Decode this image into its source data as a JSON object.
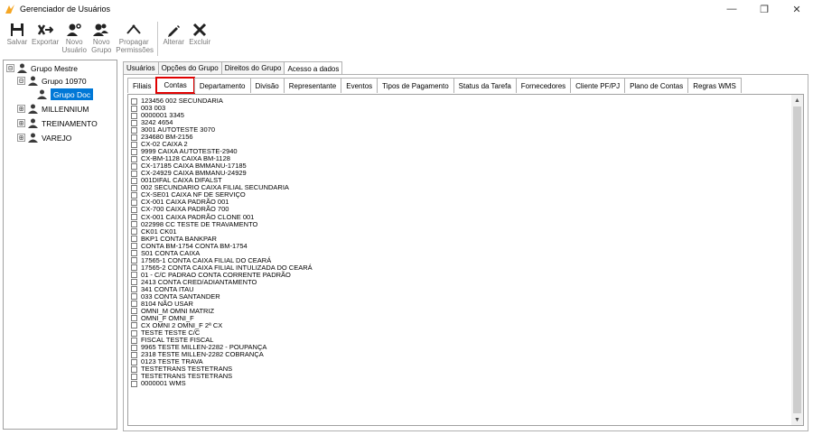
{
  "window": {
    "title": "Gerenciador de Usuários",
    "controls": [
      "—",
      "❐",
      "✕"
    ]
  },
  "toolbar": {
    "buttons": [
      {
        "label": "Salvar",
        "icon": "save-icon"
      },
      {
        "label": "Exportar",
        "icon": "export-icon"
      },
      {
        "label": "Novo Usuário",
        "icon": "new-user-icon"
      },
      {
        "label": "Novo Grupo",
        "icon": "new-group-icon"
      },
      {
        "label": "Propagar Permissões",
        "icon": "propagate-icon"
      },
      {
        "label": "Alterar",
        "icon": "edit-pencil-icon"
      },
      {
        "label": "Excluir",
        "icon": "delete-x-icon"
      }
    ]
  },
  "tree": {
    "root": {
      "expander": "⊟",
      "label": "Grupo Mestre"
    },
    "group": {
      "expander": "⊟",
      "label": "Grupo 10970"
    },
    "selected": {
      "label": "Grupo Doc"
    },
    "others": [
      {
        "expander": "⊞",
        "label": "MILLENNIUM"
      },
      {
        "expander": "⊞",
        "label": "TREINAMENTO"
      },
      {
        "expander": "⊞",
        "label": "VAREJO"
      }
    ]
  },
  "top_tabs": [
    "Usuários",
    "Opções do Grupo",
    "Direitos do Grupo",
    "Acesso a dados"
  ],
  "top_tab_active": 3,
  "inner_tabs": [
    "Filiais",
    "Contas",
    "Departamento",
    "Divisão",
    "Representante",
    "Eventos",
    "Tipos de Pagamento",
    "Status da Tarefa",
    "Fornecedores",
    "Cliente PF/PJ",
    "Plano de Contas",
    "Regras WMS"
  ],
  "inner_tab_active": 1,
  "accounts": [
    "123456 002 SECUNDARIA",
    "003 003",
    "0000001 3345",
    "3242 4654",
    "3001 AUTOTESTE 3070",
    "234680 BM-2156",
    "CX-02 CAIXA 2",
    "9999 CAIXA AUTOTESTE-2940",
    "CX-BM-1128 CAIXA BM-1128",
    "CX-17185 CAIXA BMMANU-17185",
    "CX-24929 CAIXA BMMANU-24929",
    "001DIFAL CAIXA DIFALST",
    "002 SECUNDARIO CAIXA FILIAL SECUNDARIA",
    "CX-SE01 CAIXA NF DE SERVIÇO",
    "CX-001 CAIXA PADRÃO 001",
    "CX-700 CAIXA PADRÃO 700",
    "CX-001 CAIXA PADRÃO CLONE 001",
    "022998 CC TESTE DE TRAVAMENTO",
    "CK01 CK01",
    "BKP1 CONTA BANKPAR",
    "CONTA BM-1754 CONTA BM-1754",
    "S01 CONTA CAIXA",
    "17565-1 CONTA CAIXA FILIAL DO CEARÁ",
    "17565-2 CONTA CAIXA FILIAL INTULIZADA DO CEARÁ",
    "01 - C/C PADRAO CONTA CORRENTE PADRÃO",
    "2413 CONTA CRED/ADIANTAMENTO",
    "341 CONTA ITAU",
    "033 CONTA SANTANDER",
    "8104 NÃO USAR",
    "OMNI_M OMNI MATRIZ",
    "OMNI_F OMNI_F",
    "CX OMNI 2 OMNI_F 2ª CX",
    "TESTE TESTE C/C",
    "FISCAL TESTE FISCAL",
    "9965 TESTE MILLEN-2282 - POUPANÇA",
    "2318 TESTE MILLEN-2282 COBRANÇA",
    "0123 TESTE TRAVA",
    "TESTETRANS TESTETRANS",
    "TESTETRANS TESTETRANS",
    "0000001 WMS"
  ],
  "scroll_arrows": {
    "up": "▲",
    "down": "▼"
  },
  "colors": {
    "selection": "#0078d7",
    "highlight": "#e00000",
    "app_icon": "#f5a623"
  }
}
